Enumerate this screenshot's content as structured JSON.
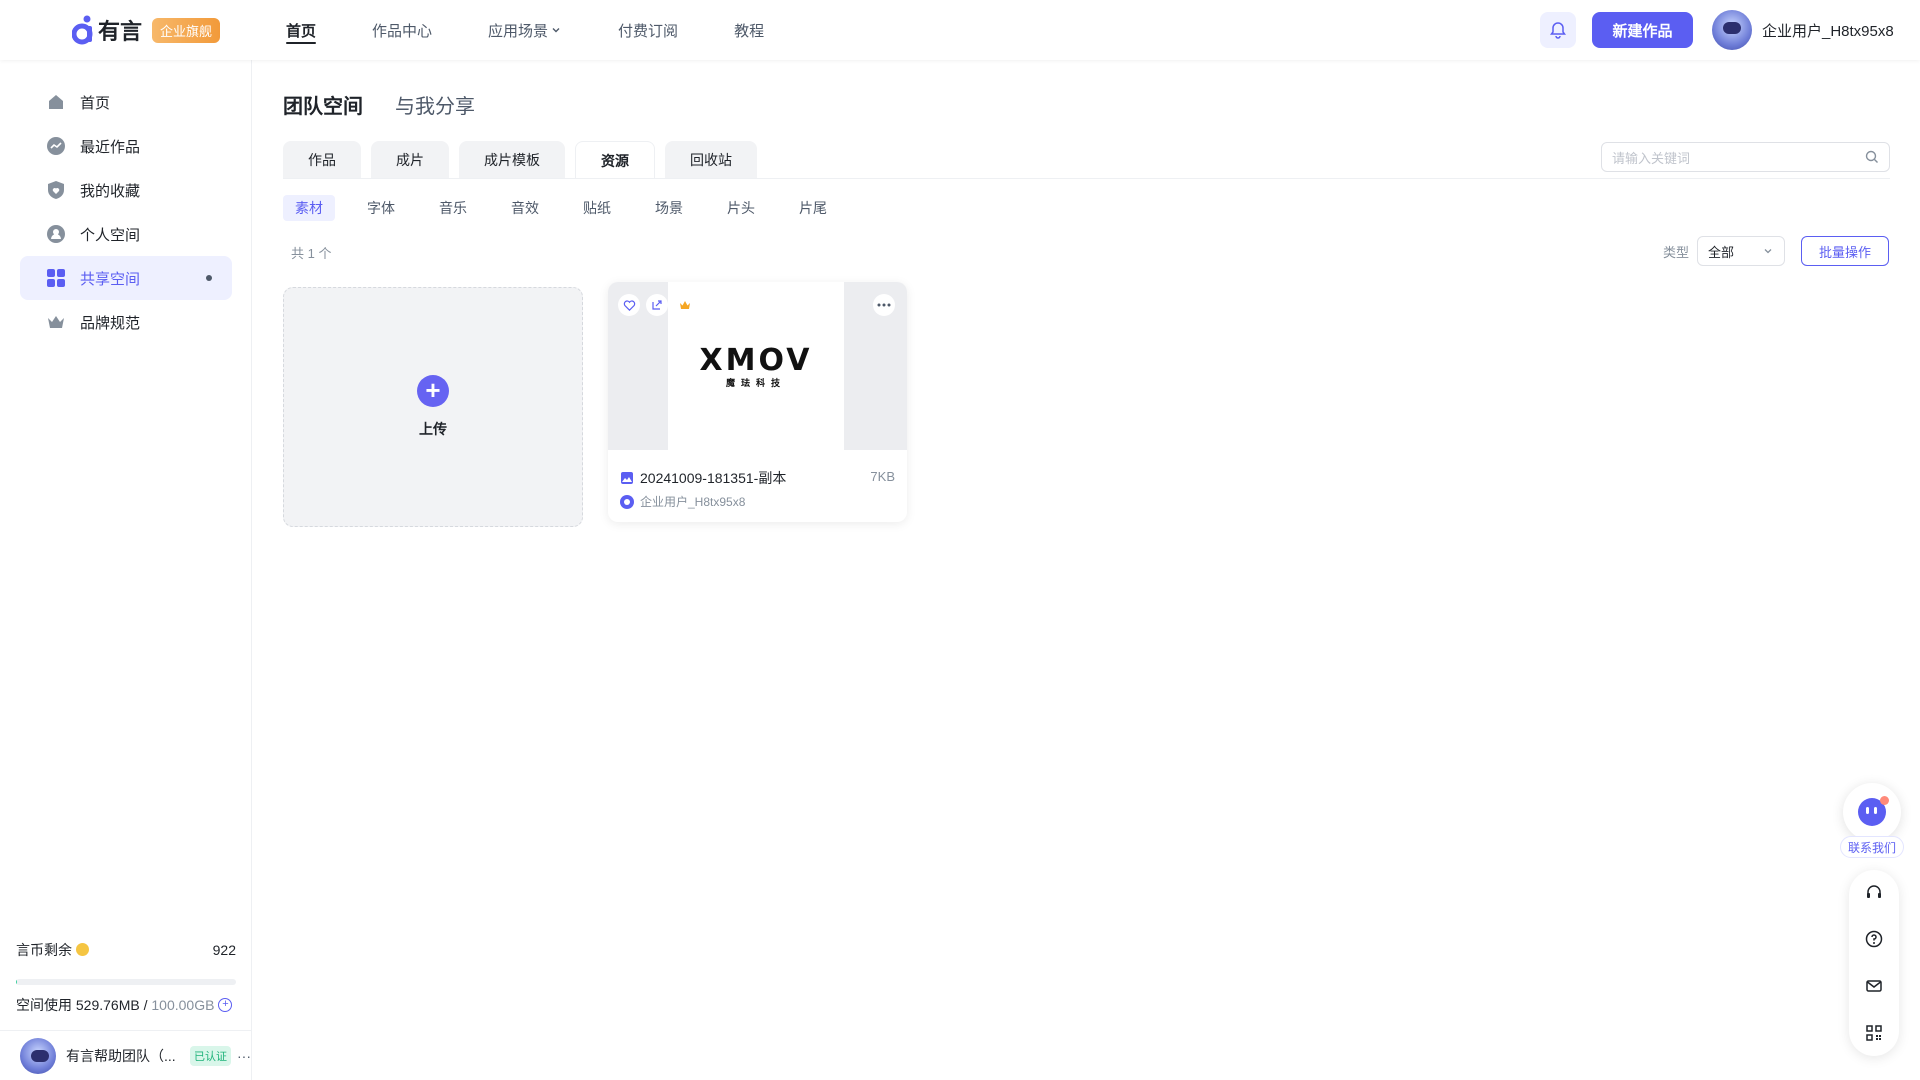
{
  "app": {
    "logo_text": "有言",
    "badge": "企业旗舰"
  },
  "nav": [
    {
      "label": "首页",
      "active": true
    },
    {
      "label": "作品中心",
      "active": false
    },
    {
      "label": "应用场景",
      "active": false,
      "has_dropdown": true
    },
    {
      "label": "付费订阅",
      "active": false
    },
    {
      "label": "教程",
      "active": false
    }
  ],
  "header": {
    "new_button": "新建作品",
    "user_name": "企业用户_H8tx95x8",
    "bell_icon": "bell-icon"
  },
  "sidebar": {
    "items": [
      {
        "label": "首页",
        "icon": "home-icon"
      },
      {
        "label": "最近作品",
        "icon": "trend-icon"
      },
      {
        "label": "我的收藏",
        "icon": "heart-shield-icon"
      },
      {
        "label": "个人空间",
        "icon": "user-icon"
      },
      {
        "label": "共享空间",
        "icon": "grid-icon",
        "active": true
      },
      {
        "label": "品牌规范",
        "icon": "crown-icon"
      }
    ],
    "coins_label": "言币剩余",
    "coins_value": "922",
    "storage_label": "空间使用",
    "storage_used": "529.76MB",
    "storage_sep": " / ",
    "storage_total": "100.00GB",
    "storage_fraction": 0.005,
    "team_name": "有言帮助团队（...",
    "team_badge": "已认证",
    "team_more": "···"
  },
  "main": {
    "space_tabs": [
      {
        "label": "团队空间",
        "active": true
      },
      {
        "label": "与我分享",
        "active": false
      }
    ],
    "category_tabs": [
      {
        "label": "作品",
        "active": false
      },
      {
        "label": "成片",
        "active": false
      },
      {
        "label": "成片模板",
        "active": false
      },
      {
        "label": "资源",
        "active": true
      },
      {
        "label": "回收站",
        "active": false
      }
    ],
    "search_placeholder": "请输入关键词",
    "sub_tabs": [
      {
        "label": "素材",
        "active": true
      },
      {
        "label": "字体",
        "active": false
      },
      {
        "label": "音乐",
        "active": false
      },
      {
        "label": "音效",
        "active": false
      },
      {
        "label": "贴纸",
        "active": false
      },
      {
        "label": "场景",
        "active": false
      },
      {
        "label": "片头",
        "active": false
      },
      {
        "label": "片尾",
        "active": false
      }
    ],
    "count_text": "共 1 个",
    "filter_label": "类型",
    "filter_value": "全部",
    "batch_button": "批量操作",
    "upload_label": "上传",
    "card": {
      "logo_text": "XMOV",
      "logo_sub": "魔珐科技",
      "title": "20241009-181351-副本",
      "size": "7KB",
      "owner": "企业用户_H8tx95x8"
    }
  },
  "floating": {
    "contact_label": "联系我们"
  },
  "colors": {
    "accent": "#5b5ef2",
    "accent_light": "#eef0ff",
    "badge": "#f29a3a",
    "verified": "#1fb37a"
  }
}
